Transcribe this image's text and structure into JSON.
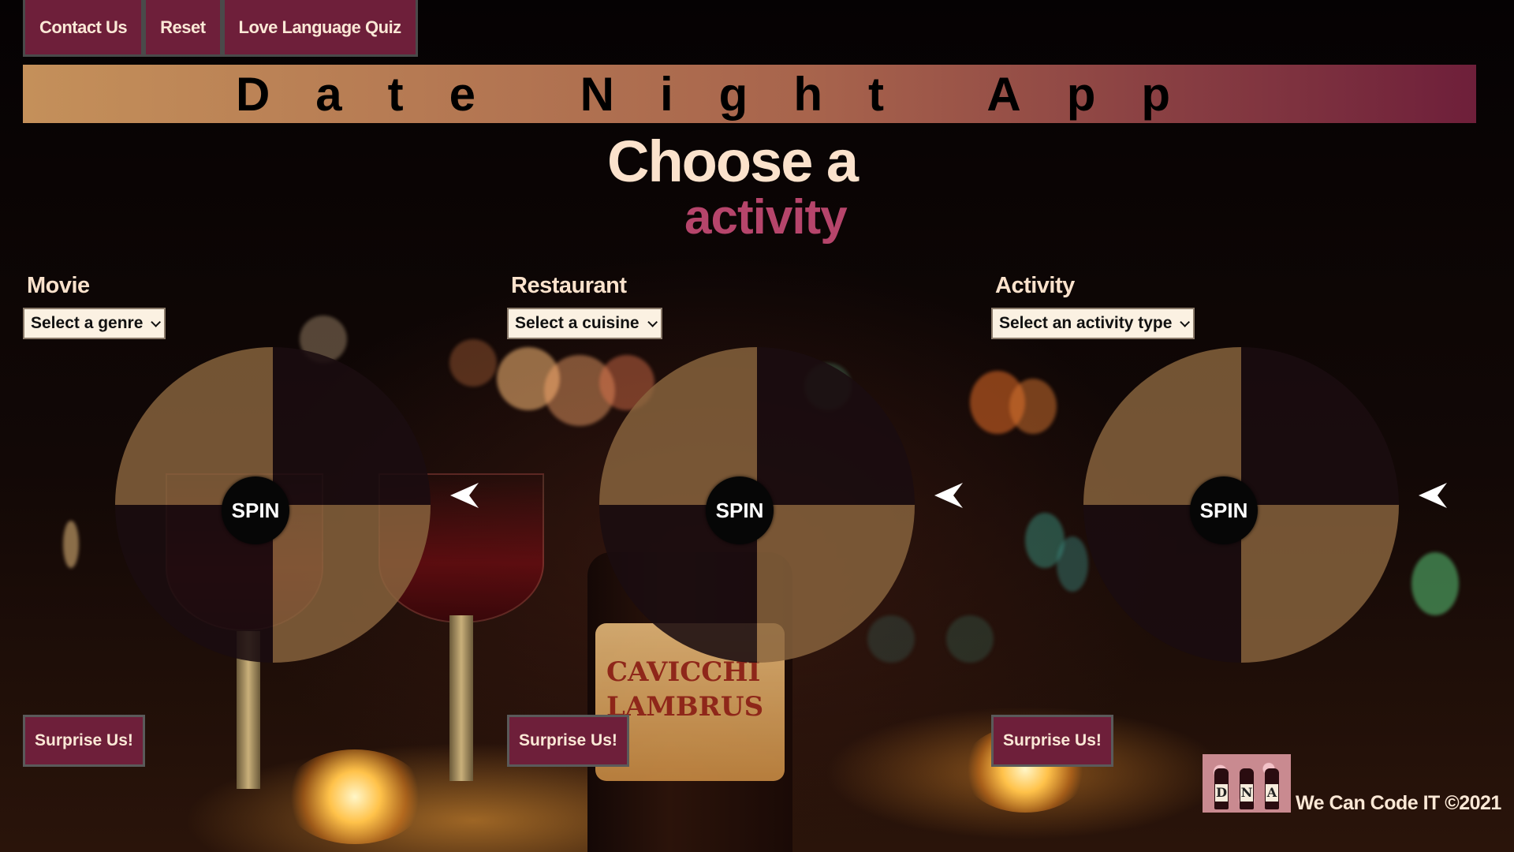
{
  "nav": {
    "contact_label": "Contact Us",
    "reset_label": "Reset",
    "quiz_label": "Love Language Quiz"
  },
  "banner": {
    "title": "Date Night App"
  },
  "heading": {
    "line1": "Choose a",
    "line2": "activity"
  },
  "columns": [
    {
      "label": "Movie",
      "select_value": "Select a genre",
      "spin_label": "SPIN",
      "surprise_label": "Surprise Us!"
    },
    {
      "label": "Restaurant",
      "select_value": "Select a cuisine",
      "spin_label": "SPIN",
      "surprise_label": "Surprise Us!"
    },
    {
      "label": "Activity",
      "select_value": "Select an activity type",
      "spin_label": "SPIN",
      "surprise_label": "Surprise Us!"
    }
  ],
  "footer": {
    "copyright": "We Can Code IT ©2021",
    "logo_letters": [
      "D",
      "N",
      "A"
    ]
  },
  "colors": {
    "accent": "#6e1f3a",
    "banner_start": "#c4905a",
    "banner_end": "#6e1f3a",
    "heading_light": "#fbe2cc",
    "heading_pink": "#b6456b",
    "wheel_light": "#8a653e",
    "wheel_dark": "#1a0c10"
  },
  "icons": {
    "dropdown": "chevron-down-icon",
    "pointer": "arrow-pointer-icon"
  }
}
